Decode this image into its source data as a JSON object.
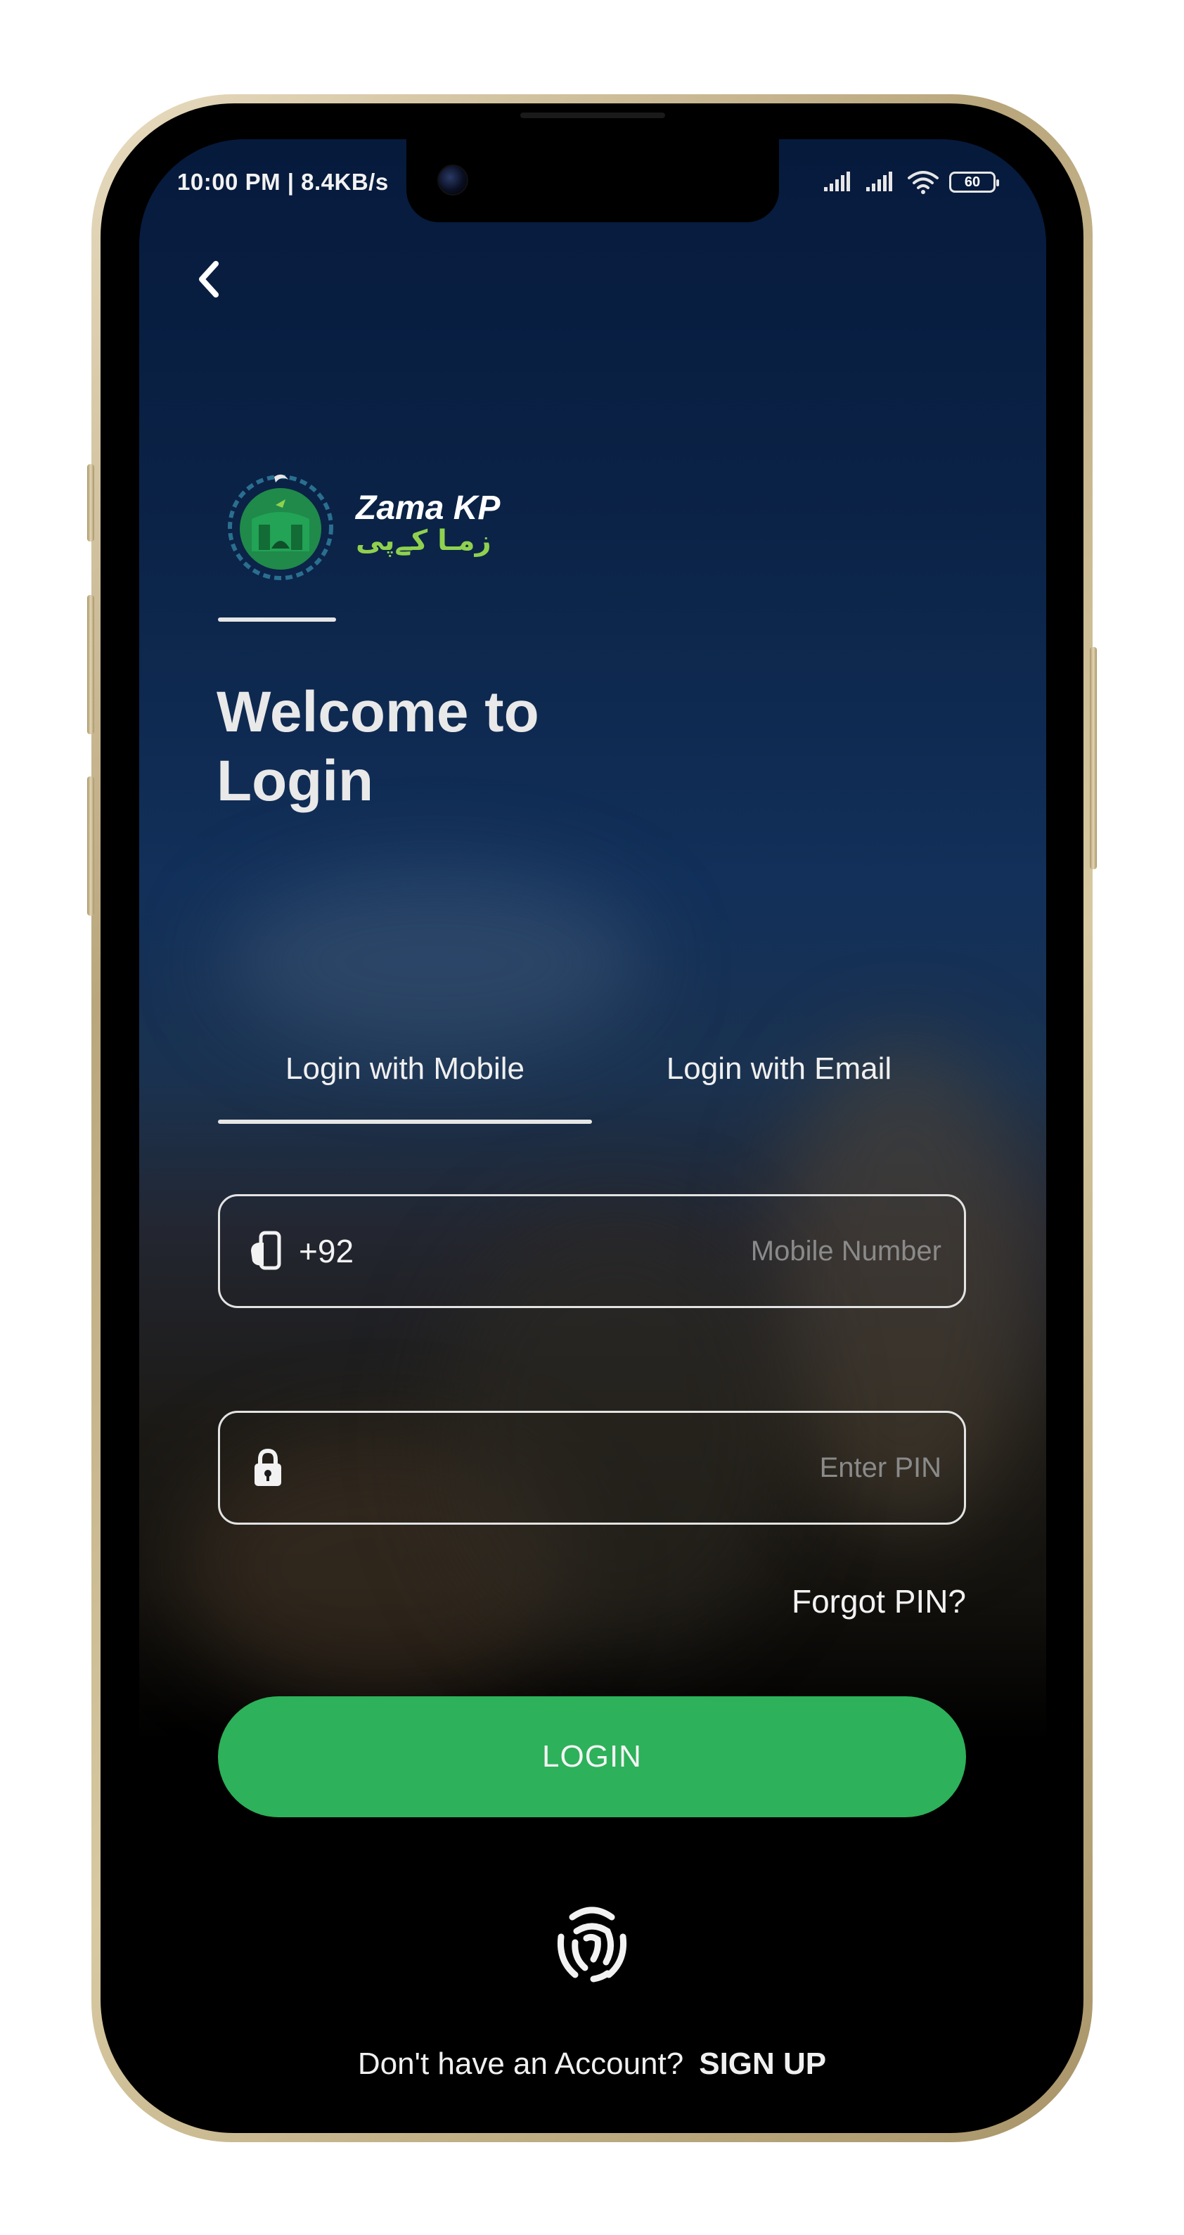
{
  "status_bar": {
    "time_speed": "10:00 PM | 8.4KB/s",
    "battery": "60"
  },
  "brand": {
    "name_en": "Zama KP",
    "name_ur": "زمـا کےپی"
  },
  "welcome": {
    "title": "Welcome to Login"
  },
  "tabs": [
    {
      "label": "Login with Mobile",
      "active": true
    },
    {
      "label": "Login with Email",
      "active": false
    }
  ],
  "form": {
    "country_code": "+92",
    "mobile_placeholder": "Mobile Number",
    "pin_placeholder": "Enter PIN",
    "forgot_label": "Forgot PIN?",
    "login_label": "LOGIN"
  },
  "footer": {
    "question": "Don't have an Account?",
    "signup_label": "SIGN UP"
  },
  "colors": {
    "accent_green": "#2db15a",
    "background_top": "#061a3c",
    "logo_green": "#8fd14f"
  },
  "icons": {
    "back": "chevron-left-icon",
    "phone": "phone-hand-icon",
    "lock": "lock-icon",
    "fingerprint": "fingerprint-icon",
    "signal": "signal-icon",
    "wifi": "wifi-icon",
    "battery": "battery-icon"
  }
}
